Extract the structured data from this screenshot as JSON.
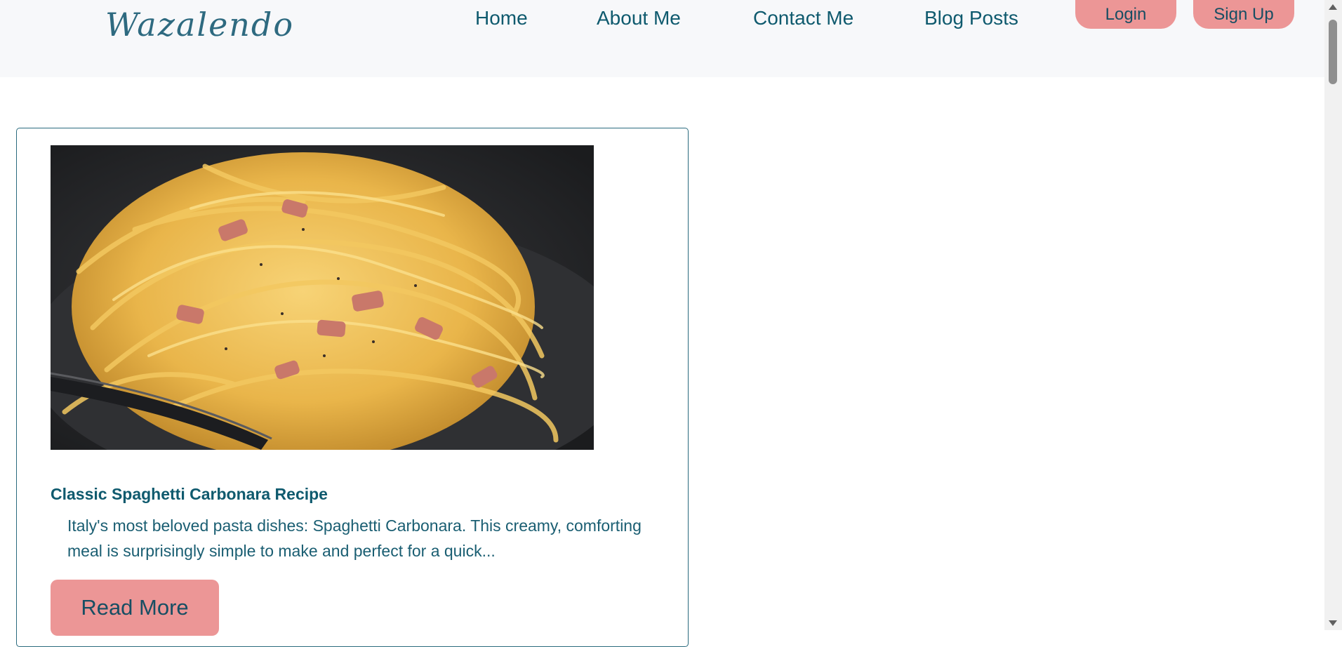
{
  "header": {
    "logo": "Wazalendo",
    "nav": [
      {
        "label": "Home"
      },
      {
        "label": "About Me"
      },
      {
        "label": "Contact Me"
      },
      {
        "label": "Blog Posts"
      }
    ],
    "login_label": "Login",
    "signup_label": "Sign Up"
  },
  "post": {
    "image_icon": "spaghetti-carbonara-photo",
    "title": "Classic Spaghetti Carbonara Recipe",
    "excerpt": "Italy's most beloved pasta dishes: Spaghetti Carbonara. This creamy, comforting meal is surprisingly simple to make and perfect for a quick...",
    "read_more_label": "Read More"
  },
  "colors": {
    "accent": "#ec9696",
    "text": "#0f5a6e",
    "header_bg": "#f7f8fa"
  }
}
